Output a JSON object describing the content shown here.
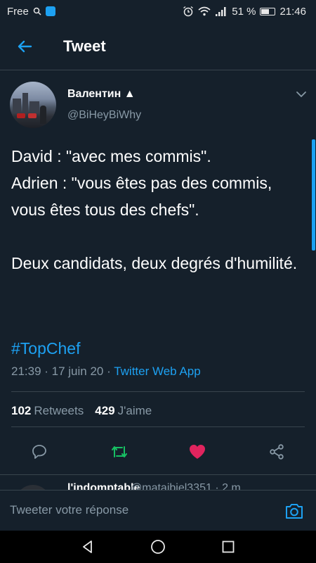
{
  "status_bar": {
    "carrier": "Free",
    "battery_percent": "51 %",
    "battery_level": 0.51,
    "time": "21:46",
    "icons": [
      "search-icon",
      "shield-icon",
      "alarm-icon",
      "wifi-icon",
      "signal-icon",
      "battery-icon"
    ]
  },
  "app_bar": {
    "title": "Tweet",
    "back_icon": "arrow-left-icon"
  },
  "tweet": {
    "author": {
      "display_name": "Валентин ▲",
      "handle": "@BiHeyBiWhy"
    },
    "text": "David : \"avec mes commis\".\nAdrien : \"vous êtes pas des commis, vous êtes tous des chefs\".\n\nDeux candidats, deux degrés d'humilité.",
    "hashtag": "#TopChef",
    "timestamp": "21:39 · 17 juin 20 · ",
    "source": "Twitter Web App",
    "retweets_count": "102",
    "retweets_label": "Retweets",
    "likes_count": "429",
    "likes_label": "J'aime",
    "actions": [
      "reply-icon",
      "retweet-icon",
      "like-icon",
      "share-icon"
    ],
    "colors": {
      "accent": "#1da1f2",
      "retweet": "#17bf63",
      "like": "#e0245e",
      "secondary_text": "#8899a6"
    }
  },
  "reply_preview": {
    "name": "l'indomptable",
    "handle": "@mataibiel3351 · 2 m"
  },
  "compose": {
    "placeholder": "Tweeter votre réponse",
    "camera_icon": "camera-icon"
  },
  "nav_bar": {
    "buttons": [
      "back-triangle-icon",
      "home-circle-icon",
      "recents-square-icon"
    ]
  }
}
